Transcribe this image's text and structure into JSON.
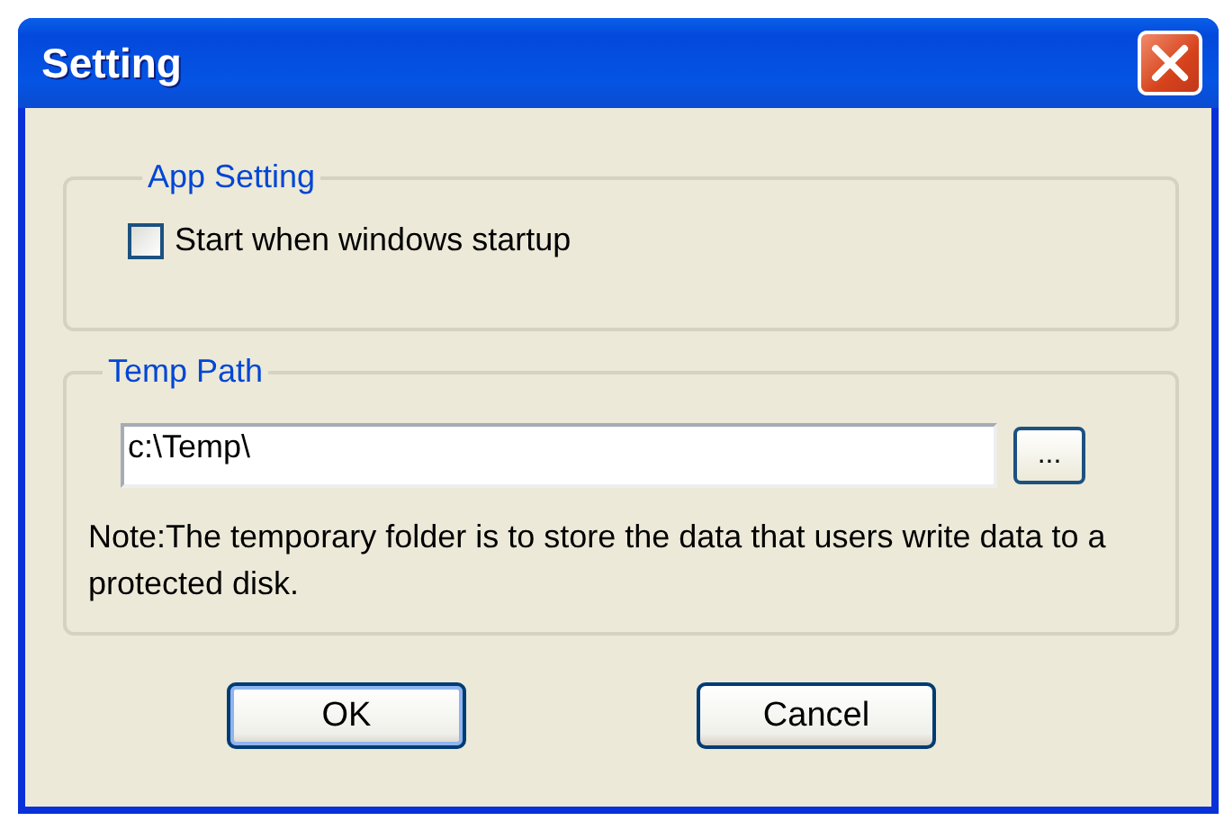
{
  "window": {
    "title": "Setting"
  },
  "groups": [
    {
      "kind": "options",
      "title": "App Setting",
      "checkbox": {
        "label": "Start when windows startup",
        "checked": false
      }
    },
    {
      "kind": "path",
      "title": "Temp Path",
      "field": {
        "value": "c:\\Temp\\"
      },
      "browse_button": "...",
      "note": "Note:The temporary folder is to store the data that users write data to a protected disk."
    }
  ],
  "buttons": [
    {
      "label": "OK",
      "default": true
    },
    {
      "label": "Cancel",
      "default": false
    }
  ]
}
